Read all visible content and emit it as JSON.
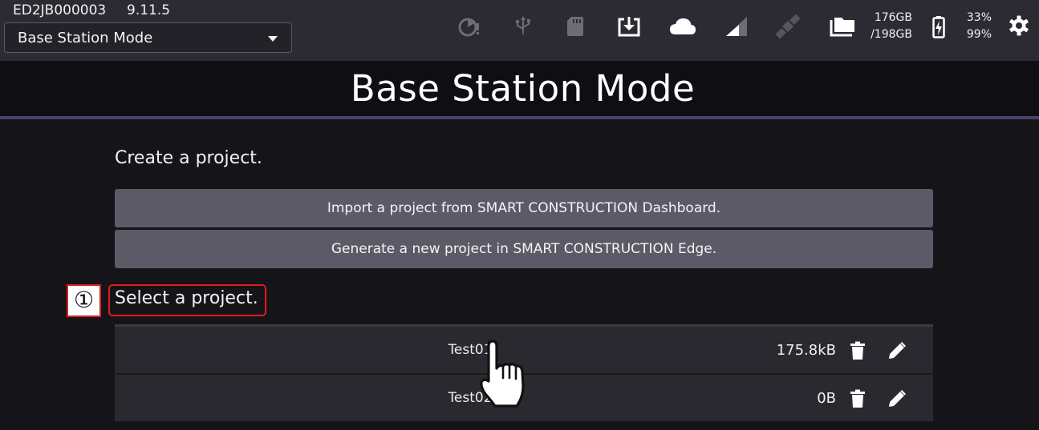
{
  "header": {
    "device_id": "ED2JB000003",
    "version": "9.11.5",
    "mode_select": {
      "selected": "Base Station Mode"
    },
    "status_icons": [
      "progress-icon",
      "usb-icon",
      "sd-card-icon",
      "download-icon",
      "cloud-icon",
      "signal-icon",
      "satellite-icon",
      "storage-icon",
      "battery-icon",
      "gear-icon"
    ],
    "storage": {
      "used": "176GB",
      "total": "/198GB"
    },
    "battery": {
      "level1": "33%",
      "level2": "99%"
    }
  },
  "page": {
    "title": "Base Station Mode"
  },
  "create": {
    "label": "Create a project.",
    "import_button": "Import a project from SMART CONSTRUCTION Dashboard.",
    "generate_button": "Generate a new project in SMART CONSTRUCTION Edge."
  },
  "select": {
    "marker": "①",
    "label": "Select a project."
  },
  "projects": [
    {
      "name": "Test01",
      "size": "175.8kB"
    },
    {
      "name": "Test02",
      "size": "0B"
    }
  ],
  "colors": {
    "topbar": "#2c2b33",
    "background": "#151419",
    "button": "#5b5a66",
    "row": "#2a292f",
    "highlight": "#e01d1d",
    "divider": "#45456a"
  }
}
